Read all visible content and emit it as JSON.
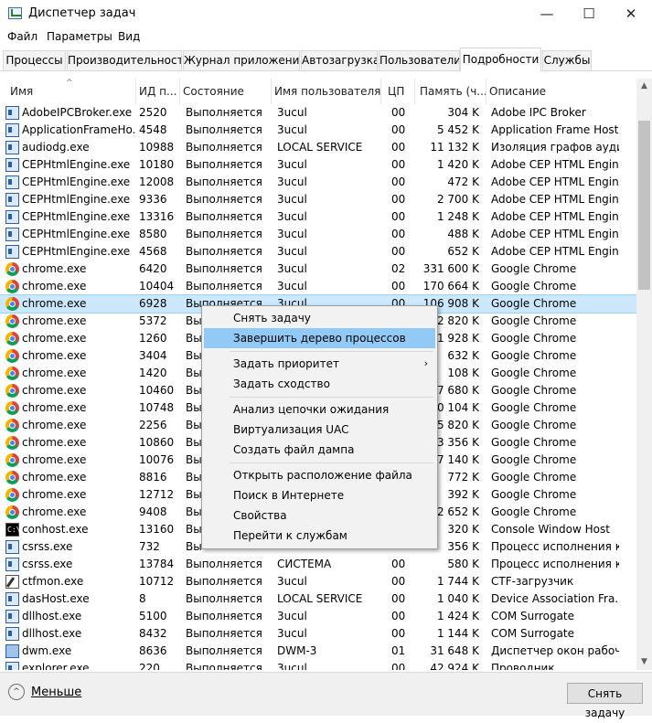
{
  "window": {
    "title": "Диспетчер задач",
    "minimize": "—",
    "maximize": "☐",
    "close": "✕"
  },
  "menu": [
    "Файл",
    "Параметры",
    "Вид"
  ],
  "tabs": [
    {
      "label": "Процессы",
      "active": false
    },
    {
      "label": "Производительность",
      "active": false
    },
    {
      "label": "Журнал приложений",
      "active": false
    },
    {
      "label": "Автозагрузка",
      "active": false
    },
    {
      "label": "Пользователи",
      "active": false
    },
    {
      "label": "Подробности",
      "active": true
    },
    {
      "label": "Службы",
      "active": false
    }
  ],
  "columns": [
    "Имя",
    "ИД п...",
    "Состояние",
    "Имя пользователя",
    "ЦП",
    "Память (ч...",
    "Описание"
  ],
  "sort_arrow": "^",
  "rows": [
    {
      "icon": "app",
      "name": "AdobeIPCBroker.exe",
      "pid": "2520",
      "state": "Выполняется",
      "user": "3ucul",
      "cpu": "00",
      "mem": "304 K",
      "desc": "Adobe IPC Broker"
    },
    {
      "icon": "app",
      "name": "ApplicationFrameHo...",
      "pid": "4548",
      "state": "Выполняется",
      "user": "3ucul",
      "cpu": "00",
      "mem": "5 452 K",
      "desc": "Application Frame Host"
    },
    {
      "icon": "app",
      "name": "audiodg.exe",
      "pid": "10988",
      "state": "Выполняется",
      "user": "LOCAL SERVICE",
      "cpu": "00",
      "mem": "11 132 K",
      "desc": "Изоляция графов ауди..."
    },
    {
      "icon": "app",
      "name": "CEPHtmlEngine.exe",
      "pid": "10180",
      "state": "Выполняется",
      "user": "3ucul",
      "cpu": "00",
      "mem": "1 420 K",
      "desc": "Adobe CEP HTML Engine"
    },
    {
      "icon": "app",
      "name": "CEPHtmlEngine.exe",
      "pid": "12008",
      "state": "Выполняется",
      "user": "3ucul",
      "cpu": "00",
      "mem": "472 K",
      "desc": "Adobe CEP HTML Engine"
    },
    {
      "icon": "app",
      "name": "CEPHtmlEngine.exe",
      "pid": "9336",
      "state": "Выполняется",
      "user": "3ucul",
      "cpu": "00",
      "mem": "2 700 K",
      "desc": "Adobe CEP HTML Engine"
    },
    {
      "icon": "app",
      "name": "CEPHtmlEngine.exe",
      "pid": "13316",
      "state": "Выполняется",
      "user": "3ucul",
      "cpu": "00",
      "mem": "1 248 K",
      "desc": "Adobe CEP HTML Engine"
    },
    {
      "icon": "app",
      "name": "CEPHtmlEngine.exe",
      "pid": "8580",
      "state": "Выполняется",
      "user": "3ucul",
      "cpu": "00",
      "mem": "488 K",
      "desc": "Adobe CEP HTML Engine"
    },
    {
      "icon": "app",
      "name": "CEPHtmlEngine.exe",
      "pid": "4568",
      "state": "Выполняется",
      "user": "3ucul",
      "cpu": "00",
      "mem": "652 K",
      "desc": "Adobe CEP HTML Engine"
    },
    {
      "icon": "chrome",
      "name": "chrome.exe",
      "pid": "6420",
      "state": "Выполняется",
      "user": "3ucul",
      "cpu": "02",
      "mem": "331 600 K",
      "desc": "Google Chrome"
    },
    {
      "icon": "chrome",
      "name": "chrome.exe",
      "pid": "10404",
      "state": "Выполняется",
      "user": "3ucul",
      "cpu": "00",
      "mem": "170 664 K",
      "desc": "Google Chrome"
    },
    {
      "icon": "chrome",
      "name": "chrome.exe",
      "pid": "6928",
      "state": "Выполняется",
      "user": "3ucul",
      "cpu": "00",
      "mem": "106 908 K",
      "desc": "Google Chrome",
      "selected": true
    },
    {
      "icon": "chrome",
      "name": "chrome.exe",
      "pid": "5372",
      "state": "Вы",
      "user": "",
      "cpu": "",
      "mem": "2 820 K",
      "desc": "Google Chrome"
    },
    {
      "icon": "chrome",
      "name": "chrome.exe",
      "pid": "1260",
      "state": "Вы",
      "user": "",
      "cpu": "",
      "mem": "11 928 K",
      "desc": "Google Chrome"
    },
    {
      "icon": "chrome",
      "name": "chrome.exe",
      "pid": "3404",
      "state": "Вы",
      "user": "",
      "cpu": "",
      "mem": "632 K",
      "desc": "Google Chrome"
    },
    {
      "icon": "chrome",
      "name": "chrome.exe",
      "pid": "1420",
      "state": "Вы",
      "user": "",
      "cpu": "",
      "mem": "108 K",
      "desc": "Google Chrome"
    },
    {
      "icon": "chrome",
      "name": "chrome.exe",
      "pid": "10460",
      "state": "Вы",
      "user": "",
      "cpu": "",
      "mem": "97 680 K",
      "desc": "Google Chrome"
    },
    {
      "icon": "chrome",
      "name": "chrome.exe",
      "pid": "10748",
      "state": "Вы",
      "user": "",
      "cpu": "",
      "mem": "80 104 K",
      "desc": "Google Chrome"
    },
    {
      "icon": "chrome",
      "name": "chrome.exe",
      "pid": "2256",
      "state": "Вы",
      "user": "",
      "cpu": "",
      "mem": "5 820 K",
      "desc": "Google Chrome"
    },
    {
      "icon": "chrome",
      "name": "chrome.exe",
      "pid": "10860",
      "state": "Вы",
      "user": "",
      "cpu": "",
      "mem": "33 356 K",
      "desc": "Google Chrome"
    },
    {
      "icon": "chrome",
      "name": "chrome.exe",
      "pid": "10076",
      "state": "Вы",
      "user": "",
      "cpu": "",
      "mem": "7 140 K",
      "desc": "Google Chrome"
    },
    {
      "icon": "chrome",
      "name": "chrome.exe",
      "pid": "8816",
      "state": "Вы",
      "user": "",
      "cpu": "",
      "mem": "772 K",
      "desc": "Google Chrome"
    },
    {
      "icon": "chrome",
      "name": "chrome.exe",
      "pid": "12712",
      "state": "Вы",
      "user": "",
      "cpu": "",
      "mem": "392 K",
      "desc": "Google Chrome"
    },
    {
      "icon": "chrome",
      "name": "chrome.exe",
      "pid": "9408",
      "state": "Вы",
      "user": "",
      "cpu": "",
      "mem": "2 652 K",
      "desc": "Google Chrome"
    },
    {
      "icon": "console",
      "name": "conhost.exe",
      "pid": "13160",
      "state": "Вы",
      "user": "",
      "cpu": "",
      "mem": "320 K",
      "desc": "Console Window Host"
    },
    {
      "icon": "app",
      "name": "csrss.exe",
      "pid": "732",
      "state": "Вы",
      "user": "",
      "cpu": "",
      "mem": "356 K",
      "desc": "Процесс исполнения к..."
    },
    {
      "icon": "app",
      "name": "csrss.exe",
      "pid": "13784",
      "state": "Выполняется",
      "user": "СИСТЕМА",
      "cpu": "00",
      "mem": "580 K",
      "desc": "Процесс исполнения к..."
    },
    {
      "icon": "ctf",
      "name": "ctfmon.exe",
      "pid": "10712",
      "state": "Выполняется",
      "user": "3ucul",
      "cpu": "00",
      "mem": "1 744 K",
      "desc": "CTF-загрузчик"
    },
    {
      "icon": "app",
      "name": "dasHost.exe",
      "pid": "8",
      "state": "Выполняется",
      "user": "LOCAL SERVICE",
      "cpu": "00",
      "mem": "1 040 K",
      "desc": "Device Association Fra..."
    },
    {
      "icon": "app",
      "name": "dllhost.exe",
      "pid": "5100",
      "state": "Выполняется",
      "user": "3ucul",
      "cpu": "00",
      "mem": "1 424 K",
      "desc": "COM Surrogate"
    },
    {
      "icon": "app",
      "name": "dllhost.exe",
      "pid": "8432",
      "state": "Выполняется",
      "user": "3ucul",
      "cpu": "00",
      "mem": "1 144 K",
      "desc": "COM Surrogate"
    },
    {
      "icon": "dwm",
      "name": "dwm.exe",
      "pid": "8636",
      "state": "Выполняется",
      "user": "DWM-3",
      "cpu": "01",
      "mem": "31 648 K",
      "desc": "Диспетчер окон рабоч..."
    },
    {
      "icon": "app",
      "name": "explorer.exe",
      "pid": "220",
      "state": "Выполняется",
      "user": "3ucul",
      "cpu": "00",
      "mem": "42 924 K",
      "desc": "Проводник"
    }
  ],
  "context_menu": {
    "items": [
      {
        "label": "Снять задачу"
      },
      {
        "label": "Завершить дерево процессов",
        "highlighted": true
      },
      {
        "label": "Задать приоритет",
        "submenu": true
      },
      {
        "label": "Задать сходство"
      },
      {
        "label": "Анализ цепочки ожидания"
      },
      {
        "label": "Виртуализация UAC"
      },
      {
        "label": "Создать файл дампа"
      },
      {
        "label": "Открыть расположение файла"
      },
      {
        "label": "Поиск в Интернете"
      },
      {
        "label": "Свойства"
      },
      {
        "label": "Перейти к службам"
      }
    ],
    "submenu_arrow": "›"
  },
  "footer": {
    "less_label": "Меньше",
    "less_icon": "^",
    "end_task": "Снять задачу"
  },
  "scrollbar": {
    "up": "▲",
    "down": "▼"
  }
}
